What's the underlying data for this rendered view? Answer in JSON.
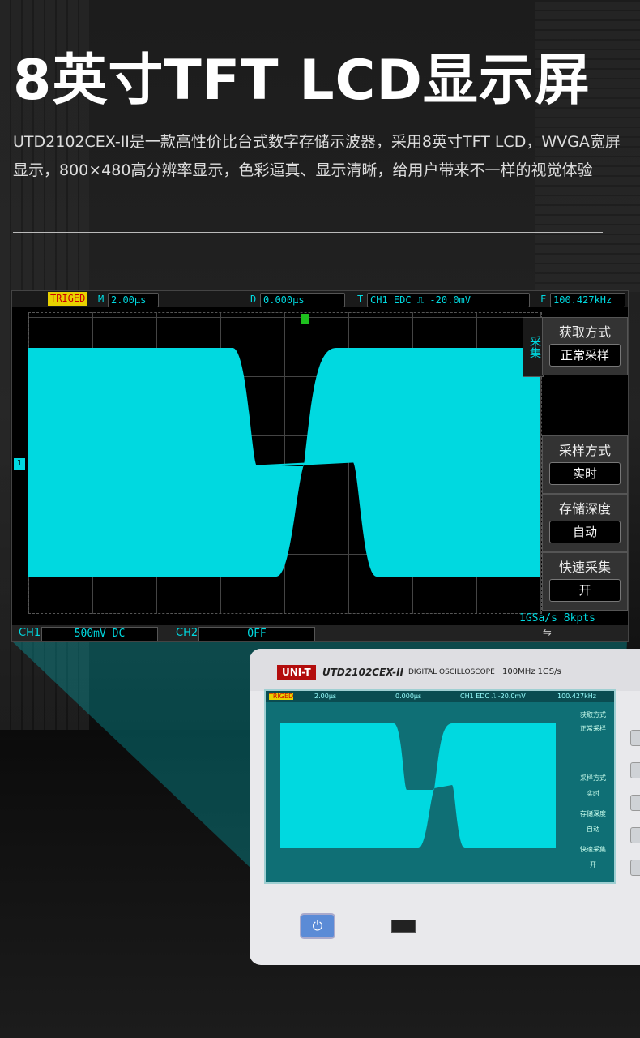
{
  "headline": "8英寸TFT LCD显示屏",
  "description": "UTD2102CEX-II是一款高性价比台式数字存储示波器，采用8英寸TFT LCD，WVGA宽屏显示，800×480高分辨率显示，色彩逼真、显示清晰，给用户带来不一样的视觉体验",
  "screen": {
    "trig_status": "TRIGED",
    "m_label": "M",
    "timebase": "2.00μs",
    "d_label": "D",
    "delay": "0.000μs",
    "t_label": "T",
    "trigger": "CH1  EDC ⎍  -20.0mV",
    "f_label": "F",
    "frequency": "100.427kHz",
    "channel_marker": "1",
    "menu_title": "采集",
    "menu": [
      {
        "title": "获取方式",
        "value": "正常采样"
      },
      {
        "title": "采样方式",
        "value": "实时"
      },
      {
        "title": "存储深度",
        "value": "自动"
      },
      {
        "title": "快速采集",
        "value": "开"
      }
    ],
    "sample_rate": "1GSa/s  8kpts",
    "ch1_label": "CH1",
    "ch1_value": "500mV  DC",
    "ch2_label": "CH2",
    "ch2_value": "OFF",
    "usb_icon": "usb-icon"
  },
  "device": {
    "brand": "UNI-T",
    "model": "UTD2102CEX-II",
    "type": "DIGITAL OSCILLOSCOPE",
    "spec": "100MHz  1GS/s",
    "mini_trig": "TRIGED",
    "mini_timebase": "2.00μs",
    "mini_delay": "0.000μs",
    "mini_trigger": "CH1  EDC ⎍  -20.0mV",
    "mini_freq": "100.427kHz",
    "mini_menu": [
      "获取方式",
      "正常采样",
      "采样方式",
      "实时",
      "存储深度",
      "自动",
      "快速采集",
      "开"
    ],
    "power_icon": "power-icon"
  },
  "colors": {
    "trace": "#00d9e0",
    "trig_bg": "#e8d100",
    "brand": "#b30d0d"
  }
}
